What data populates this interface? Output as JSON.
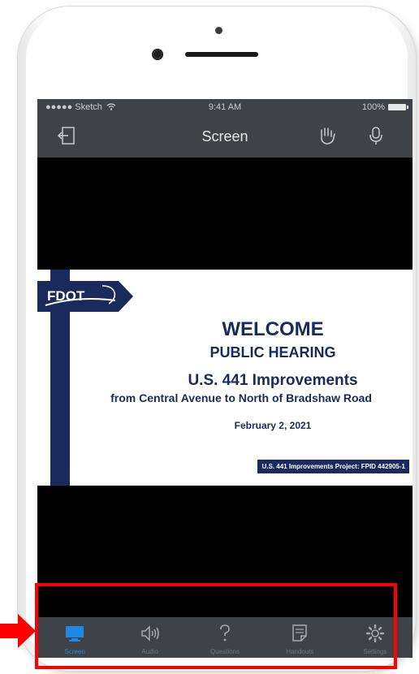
{
  "status_bar": {
    "carrier": "●●●●● Sketch",
    "time": "9:41 AM",
    "battery": "100%"
  },
  "nav": {
    "title": "Screen"
  },
  "slide": {
    "logo_text": "FDOT",
    "welcome": "WELCOME",
    "hearing": "PUBLIC HEARING",
    "project": "U.S. 441 Improvements",
    "limits": "from Central Avenue to North of Bradshaw Road",
    "date": "February 2, 2021",
    "footer": "U.S. 441 Improvements Project: FPID 442905-1"
  },
  "tabs": [
    {
      "label": "Screen",
      "icon": "monitor-icon",
      "active": true
    },
    {
      "label": "Audio",
      "icon": "speaker-icon",
      "active": false
    },
    {
      "label": "Questions",
      "icon": "question-icon",
      "active": false
    },
    {
      "label": "Handouts",
      "icon": "document-icon",
      "active": false
    },
    {
      "label": "Settings",
      "icon": "gear-icon",
      "active": false
    }
  ],
  "colors": {
    "bar_bg": "#3f4347",
    "active_tab": "#1e88e5",
    "slide_navy": "#1b2a5c",
    "highlight": "#ff0000"
  }
}
